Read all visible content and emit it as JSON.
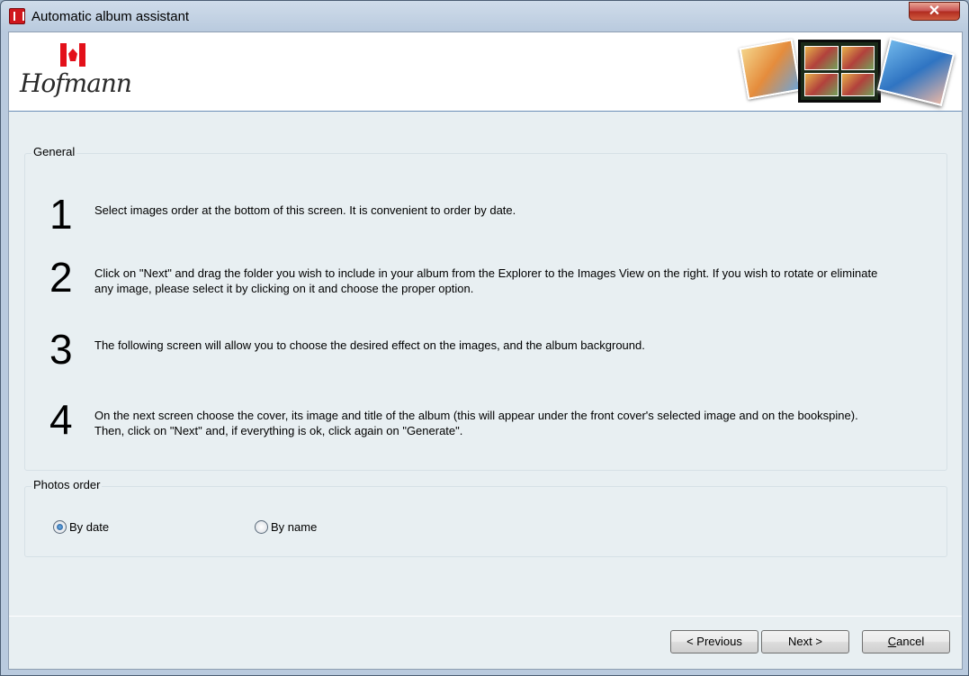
{
  "window": {
    "title": "Automatic album assistant",
    "close_symbol": "✕"
  },
  "banner": {
    "logo_text": "Hofmann"
  },
  "general": {
    "legend": "General",
    "steps": [
      {
        "num": "1",
        "text": "Select images order at the bottom of this screen. It is convenient to order by date."
      },
      {
        "num": "2",
        "text": "Click on \"Next\" and drag the folder you wish to include in your album from the Explorer to the Images View on the right. If you wish to rotate or eliminate any image, please select it by clicking on it and choose the proper option."
      },
      {
        "num": "3",
        "text": "The following screen will allow you to choose the desired effect on the images, and the album background."
      },
      {
        "num": "4",
        "text": "On the next screen choose the cover, its image and title of the album (this will appear under the front cover's selected image and on the bookspine). Then, click on \"Next\" and, if everything is ok, click again on \"Generate\"."
      }
    ]
  },
  "photos_order": {
    "legend": "Photos order",
    "options": [
      {
        "label": "By date",
        "checked": true
      },
      {
        "label": "By name",
        "checked": false
      }
    ]
  },
  "buttons": {
    "previous": "< Previous",
    "next": "Next >",
    "cancel_first": "C",
    "cancel_rest": "ancel"
  }
}
